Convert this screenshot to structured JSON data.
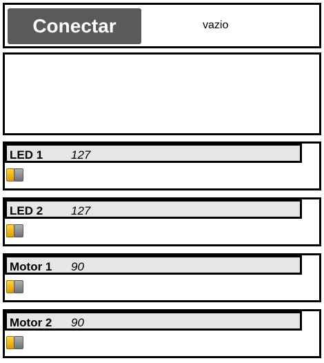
{
  "header": {
    "connect_label": "Conectar",
    "status": "vazio"
  },
  "log": {
    "text": ""
  },
  "controls": [
    {
      "name": "LED 1",
      "value": "127"
    },
    {
      "name": "LED 2",
      "value": "127"
    },
    {
      "name": "Motor 1",
      "value": "90"
    },
    {
      "name": "Motor 2",
      "value": "90"
    }
  ],
  "colors": {
    "button_bg": "#5a5a5a",
    "header_bg": "#e6e6e6",
    "handle_gold": "#e3a400",
    "handle_gray": "#8a8a8a"
  },
  "icons": {
    "slider_handle": "slider-handle-icon"
  }
}
